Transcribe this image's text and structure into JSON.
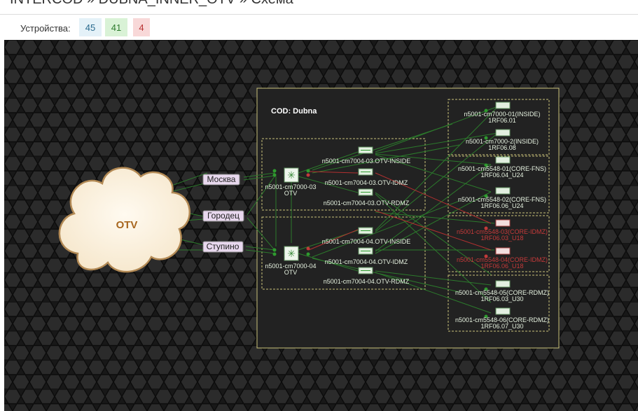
{
  "breadcrumb": "INTERCOD » DUBNA_INNER_OTV » Схема",
  "status": {
    "label": "Устройства:",
    "total": "45",
    "ok": "41",
    "err": "4"
  },
  "cloud": {
    "label": "OTV"
  },
  "cities": [
    "Москва",
    "Городец",
    "Ступино"
  ],
  "cod": {
    "title": "COD: Dubna"
  },
  "switches": [
    {
      "line1": "n5001-cm7000-03",
      "line2": "OTV"
    },
    {
      "line1": "n5001-cm7000-04",
      "line2": "OTV"
    }
  ],
  "mid_devices": [
    "n5001-cm7004-03.OTV-INSIDE",
    "n5001-cm7004-03.OTV-IDMZ",
    "n5001-cm7004-03.OTV-RDMZ",
    "n5001-cm7004-04.OTV-INSIDE",
    "n5001-cm7004-04.OTV-IDMZ",
    "n5001-cm7004-04.OTV-RDMZ"
  ],
  "right_devices": [
    {
      "line1": "n5001-cm7000-01(INSIDE)",
      "line2": "1RF06.01",
      "state": "ok"
    },
    {
      "line1": "n5001-cm7000-2(INSIDE)",
      "line2": "1RF06.08",
      "state": "ok"
    },
    {
      "line1": "n5001-cm5548-01(CORE-FNS)",
      "line2": "1RF06.04_U24",
      "state": "ok"
    },
    {
      "line1": "n5001-cm5548-02(CORE-FNS)",
      "line2": "1RF06.06_U24",
      "state": "ok"
    },
    {
      "line1": "n5001-cm5548-03(CORE-IDMZ)",
      "line2": "1RF06.03_U18",
      "state": "err"
    },
    {
      "line1": "n5001-cm5548-04(CORE-IDMZ)",
      "line2": "1RF06.06_U18",
      "state": "err"
    },
    {
      "line1": "n5001-cm5548-05(CORE-RDMZ)",
      "line2": "1RF06.03_U30",
      "state": "ok"
    },
    {
      "line1": "n5001-cm5548-06(CORE-RDMZ)",
      "line2": "1RF06.07_U30",
      "state": "ok"
    }
  ],
  "colors": {
    "ok": "#2f9a2f",
    "err": "#c23a3a",
    "link": "#2c7a2c"
  }
}
